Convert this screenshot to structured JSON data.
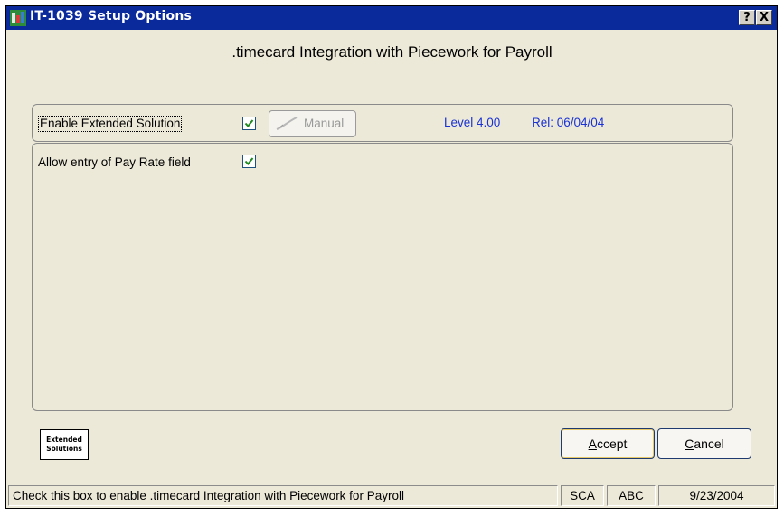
{
  "window": {
    "title": "IT-1039 Setup Options",
    "help_label": "?",
    "close_label": "X"
  },
  "heading": ".timecard Integration with Piecework for Payroll",
  "options": {
    "enable_label": "Enable Extended Solution",
    "enable_checked": true,
    "manual_label": "Manual",
    "level": "Level 4.00",
    "release": "Rel: 06/04/04",
    "payrate_label": "Allow entry of Pay Rate field",
    "payrate_checked": true
  },
  "logo": {
    "line1": "Extended",
    "line2": "Solutions"
  },
  "buttons": {
    "accept_label": "Accept",
    "cancel_label": "Cancel"
  },
  "status": {
    "message": "Check this box to enable .timecard Integration with Piecework for Payroll",
    "company": "SCA",
    "user": "ABC",
    "date": "9/23/2004"
  },
  "colors": {
    "titlebar": "#0a2a9c",
    "window_bg": "#ece9d8",
    "version_text": "#1a32d4",
    "checkmark": "#1f8a1f"
  }
}
